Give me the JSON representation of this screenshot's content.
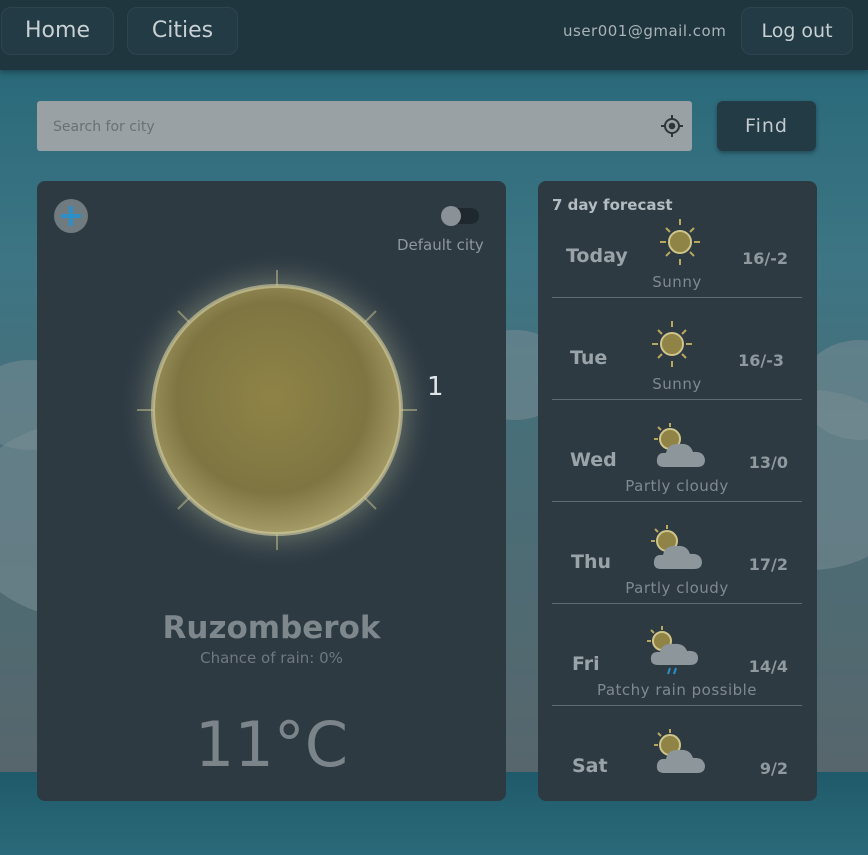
{
  "nav": {
    "home_label": "Home",
    "cities_label": "Cities",
    "email": "user001@gmail.com",
    "logout_label": "Log out"
  },
  "search": {
    "placeholder": "Search for city",
    "find_label": "Find"
  },
  "current": {
    "default_city_label": "Default city",
    "default_city_enabled": false,
    "overlay_number": "1",
    "city": "Ruzomberok",
    "rain_chance": "Chance of rain: 0%",
    "temperature": "11°C",
    "icon": "sun-icon"
  },
  "forecast": {
    "title": "7 day forecast",
    "days": [
      {
        "day": "Today",
        "temp": "16/-2",
        "condition": "Sunny",
        "icon": "sun-icon"
      },
      {
        "day": "Tue",
        "temp": "16/-3",
        "condition": "Sunny",
        "icon": "sun-icon"
      },
      {
        "day": "Wed",
        "temp": "13/0",
        "condition": "Partly cloudy",
        "icon": "partly-cloudy-icon"
      },
      {
        "day": "Thu",
        "temp": "17/2",
        "condition": "Partly cloudy",
        "icon": "partly-cloudy-icon"
      },
      {
        "day": "Fri",
        "temp": "14/4",
        "condition": "Patchy rain possible",
        "icon": "patchy-rain-icon"
      },
      {
        "day": "Sat",
        "temp": "9/2",
        "condition": "",
        "icon": "partly-cloudy-icon"
      }
    ]
  },
  "colors": {
    "accent": "#2d8fc7",
    "card": "#2d3a42",
    "navbar": "#20363f"
  }
}
